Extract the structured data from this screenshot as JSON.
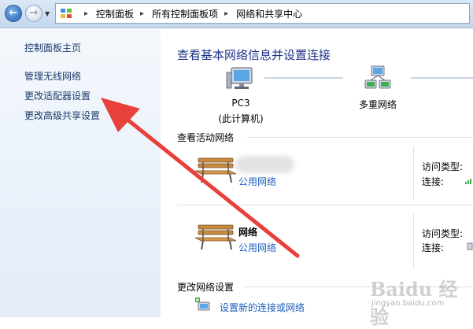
{
  "address_bar": {
    "breadcrumbs": [
      "控制面板",
      "所有控制面板项",
      "网络和共享中心"
    ],
    "icons": [
      "back-arrow",
      "forward-arrow",
      "control-panel"
    ]
  },
  "sidebar": {
    "home": "控制面板主页",
    "items": [
      "管理无线网络",
      "更改适配器设置",
      "更改高级共享设置"
    ]
  },
  "main": {
    "title": "查看基本网络信息并设置连接",
    "map": {
      "computer_name": "PC3",
      "computer_sub": "(此计算机)",
      "network_label": "多重网络"
    },
    "active_section": "查看活动网络",
    "networks": [
      {
        "name": "",
        "type_link": "公用网络",
        "access_label": "访问类型:",
        "conn_label": "连接:"
      },
      {
        "name": "网络",
        "type_link": "公用网络",
        "access_label": "访问类型:",
        "conn_label": "连接:"
      }
    ],
    "change_section": "更改网络设置",
    "setup_link": "设置新的连接或网络"
  },
  "watermark": {
    "text": "Baidu 经验",
    "sub": "jingyan.baidu.com"
  },
  "colors": {
    "link": "#1b5dbb",
    "title": "#1e3287",
    "annotation_arrow": "#e8403a"
  }
}
